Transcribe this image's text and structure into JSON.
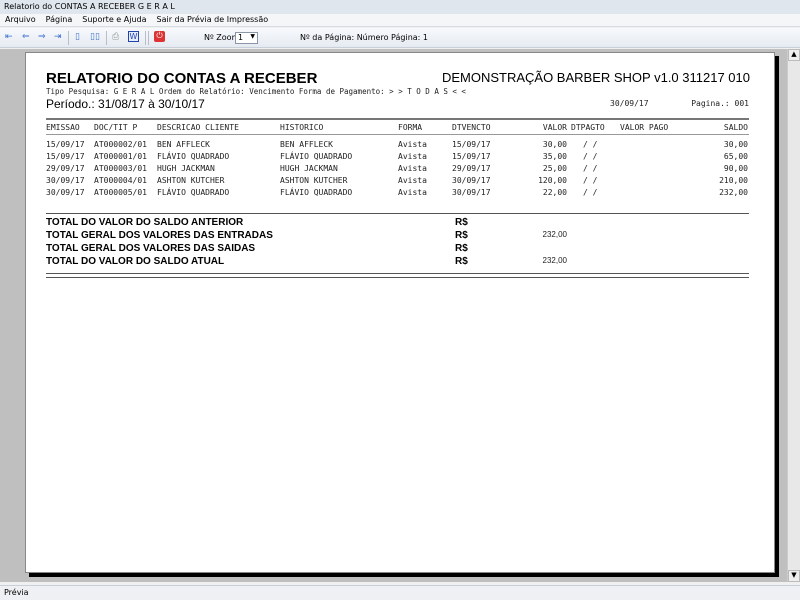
{
  "window": {
    "title": "Relatorio do CONTAS A RECEBER G E R A L"
  },
  "menu": [
    "Arquivo",
    "Página",
    "Suporte e Ajuda",
    "Sair da Prévia de Impressão"
  ],
  "toolbar": {
    "zoom_label": "Nº Zoom",
    "zoom_value": "1",
    "page_label": "Nº da Página: Número Página: 1"
  },
  "status": "Prévia",
  "report": {
    "title": "RELATORIO DO CONTAS A RECEBER",
    "company": "DEMONSTRAÇÃO BARBER SHOP v1.0 311217 010",
    "filters": "Tipo Pesquisa: G E R A L   Ordem do Relatório: Vencimento   Forma de Pagamento: > > T O D A S < <",
    "period": "Período.: 31/08/17 à 30/10/17",
    "date": "30/09/17",
    "page": "Pagina.: 001",
    "columns": [
      "EMISSAO",
      "DOC/TIT P",
      "DESCRICAO CLIENTE",
      "HISTORICO",
      "FORMA",
      "DTVENCTO",
      "VALOR",
      "DTPAGTO",
      "VALOR PAGO",
      "SALDO"
    ],
    "rows": [
      {
        "emissao": "15/09/17",
        "doc": "AT000002/01",
        "cliente": "BEN AFFLECK",
        "historico": "BEN AFFLECK",
        "forma": "Avista",
        "venc": "15/09/17",
        "valor": "30,00",
        "dtpagto": "/  /",
        "saldo": "30,00"
      },
      {
        "emissao": "15/09/17",
        "doc": "AT000001/01",
        "cliente": "FLÁVIO QUADRADO",
        "historico": "FLÁVIO QUADRADO",
        "forma": "Avista",
        "venc": "15/09/17",
        "valor": "35,00",
        "dtpagto": "/  /",
        "saldo": "65,00"
      },
      {
        "emissao": "29/09/17",
        "doc": "AT000003/01",
        "cliente": "HUGH JACKMAN",
        "historico": "HUGH JACKMAN",
        "forma": "Avista",
        "venc": "29/09/17",
        "valor": "25,00",
        "dtpagto": "/  /",
        "saldo": "90,00"
      },
      {
        "emissao": "30/09/17",
        "doc": "AT000004/01",
        "cliente": "ASHTON KUTCHER",
        "historico": "ASHTON KUTCHER",
        "forma": "Avista",
        "venc": "30/09/17",
        "valor": "120,00",
        "dtpagto": "/  /",
        "saldo": "210,00"
      },
      {
        "emissao": "30/09/17",
        "doc": "AT000005/01",
        "cliente": "FLÁVIO QUADRADO",
        "historico": "FLÁVIO QUADRADO",
        "forma": "Avista",
        "venc": "30/09/17",
        "valor": "22,00",
        "dtpagto": "/  /",
        "saldo": "232,00"
      }
    ],
    "totals": [
      {
        "label": "TOTAL DO VALOR DO SALDO ANTERIOR",
        "currency": "R$",
        "value": ""
      },
      {
        "label": "TOTAL GERAL DOS VALORES DAS ENTRADAS",
        "currency": "R$",
        "value": "232,00"
      },
      {
        "label": "TOTAL GERAL DOS VALORES DAS SAIDAS",
        "currency": "R$",
        "value": ""
      },
      {
        "label": "TOTAL DO VALOR DO SALDO ATUAL",
        "currency": "R$",
        "value": "232,00"
      }
    ]
  }
}
